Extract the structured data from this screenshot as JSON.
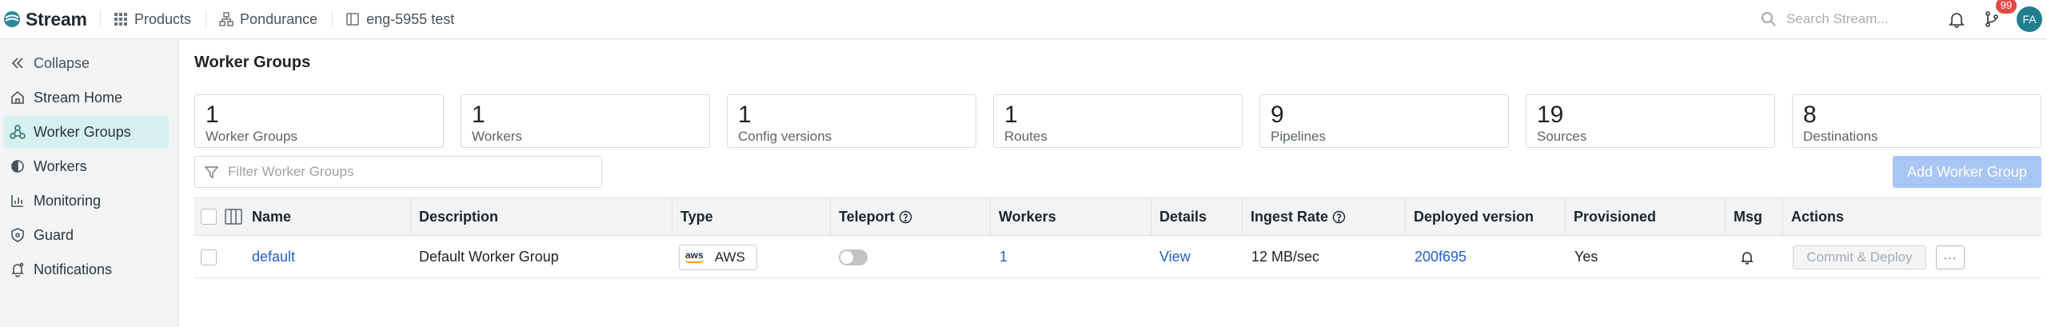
{
  "header": {
    "app_name": "Stream",
    "breadcrumbs": [
      {
        "label": "Products",
        "icon": "grid-icon"
      },
      {
        "label": "Pondurance",
        "icon": "org-icon"
      },
      {
        "label": "eng-5955 test",
        "icon": "workspace-icon"
      }
    ],
    "search_placeholder": "Search Stream...",
    "notifications_badge": "99",
    "avatar_initials": "FA"
  },
  "sidebar": {
    "items": [
      {
        "label": "Collapse",
        "icon": "double-chevron-left-icon"
      },
      {
        "label": "Stream Home",
        "icon": "home-icon"
      },
      {
        "label": "Worker Groups",
        "icon": "worker-groups-icon",
        "active": true
      },
      {
        "label": "Workers",
        "icon": "workers-icon"
      },
      {
        "label": "Monitoring",
        "icon": "chart-icon"
      },
      {
        "label": "Guard",
        "icon": "shield-icon"
      },
      {
        "label": "Notifications",
        "icon": "bell-icon"
      }
    ]
  },
  "main": {
    "title": "Worker Groups",
    "stats": [
      {
        "value": "1",
        "label": "Worker Groups"
      },
      {
        "value": "1",
        "label": "Workers"
      },
      {
        "value": "1",
        "label": "Config versions"
      },
      {
        "value": "1",
        "label": "Routes"
      },
      {
        "value": "9",
        "label": "Pipelines"
      },
      {
        "value": "19",
        "label": "Sources"
      },
      {
        "value": "8",
        "label": "Destinations"
      }
    ],
    "filter_placeholder": "Filter Worker Groups",
    "add_button": "Add Worker Group",
    "table": {
      "columns": [
        "Name",
        "Description",
        "Type",
        "Teleport",
        "Workers",
        "Details",
        "Ingest Rate",
        "Deployed version",
        "Provisioned",
        "Msg",
        "Actions"
      ],
      "rows": [
        {
          "name": "default",
          "description": "Default Worker Group",
          "type_logo": "aws",
          "type": "AWS",
          "teleport_enabled": false,
          "workers": "1",
          "details": "View",
          "ingest_rate": "12 MB/sec",
          "deployed_version": "200f695",
          "provisioned": "Yes",
          "commit_label": "Commit & Deploy",
          "more_label": "···"
        }
      ]
    }
  },
  "colors": {
    "accent": "#1f62c7",
    "active_nav_bg": "#d6f0f0",
    "add_button_bg": "#a8c6f4",
    "badge": "#e34a44",
    "avatar_bg": "#1f7f8c"
  }
}
